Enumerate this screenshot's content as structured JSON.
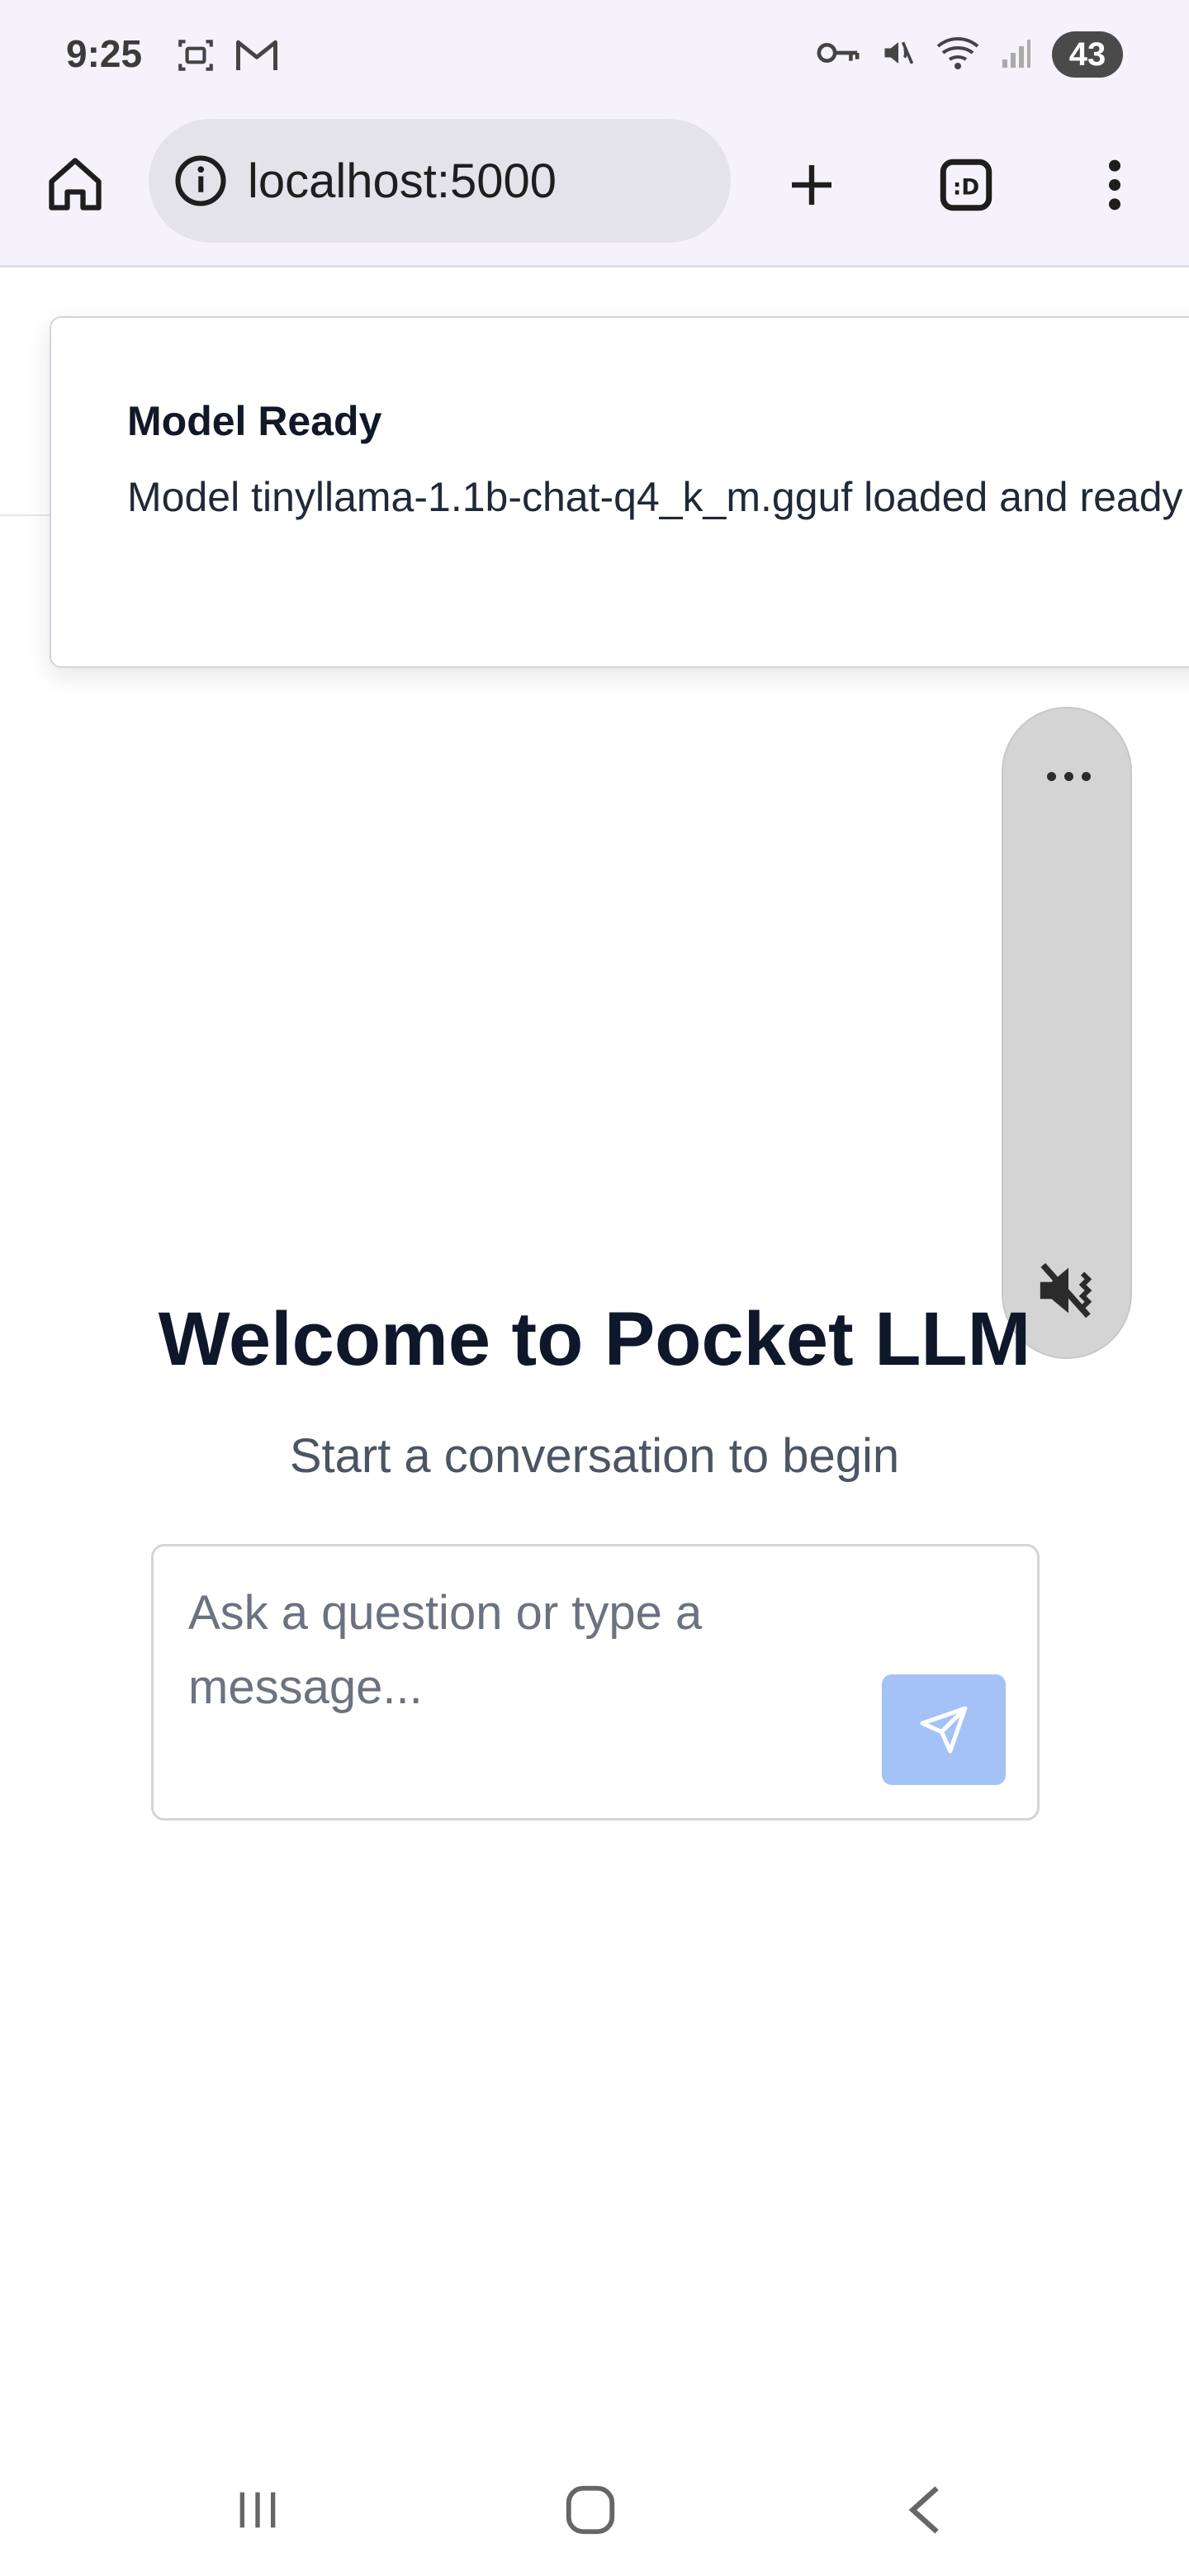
{
  "status_bar": {
    "time": "9:25",
    "battery": "43",
    "icons_left": [
      "screenshot-icon",
      "gmail-icon"
    ],
    "icons_right": [
      "vpn-key-icon",
      "mute-icon",
      "wifi-icon",
      "signal-icon"
    ]
  },
  "browser": {
    "url": "localhost:5000",
    "buttons": [
      "home",
      "site-info",
      "new-tab",
      "tab-switcher",
      "menu"
    ]
  },
  "toast": {
    "title": "Model Ready",
    "description": "Model tinyllama-1.1b-chat-q4_k_m.gguf loaded and ready"
  },
  "floating_panel": {
    "icons": [
      "more-icon",
      "mute-icon"
    ]
  },
  "welcome": {
    "title": "Welcome to Pocket LLM",
    "subtitle": "Start a conversation to begin"
  },
  "chat_input": {
    "placeholder": "Ask a question or type a message...",
    "value": "",
    "send_icon": "send-icon",
    "send_color": "#a4c2f6"
  },
  "nav_bar": {
    "buttons": [
      "recents",
      "home",
      "back"
    ]
  }
}
